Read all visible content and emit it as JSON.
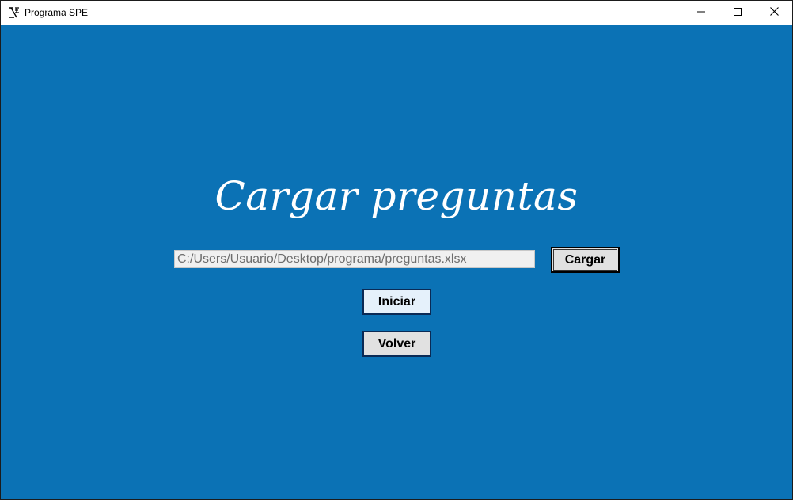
{
  "window": {
    "title": "Programa SPE",
    "controls": {
      "minimize": "minimize-icon",
      "maximize": "maximize-icon",
      "close": "close-icon"
    }
  },
  "main": {
    "heading": "Cargar preguntas",
    "file_path": "C:/Users/Usuario/Desktop/programa/preguntas.xlsx",
    "load_button": "Cargar",
    "start_button": "Iniciar",
    "back_button": "Volver"
  },
  "colors": {
    "background": "#0b72b5",
    "titlebar": "#ffffff",
    "button": "#e1e1e1",
    "button_focused": "#e5f1fb"
  }
}
